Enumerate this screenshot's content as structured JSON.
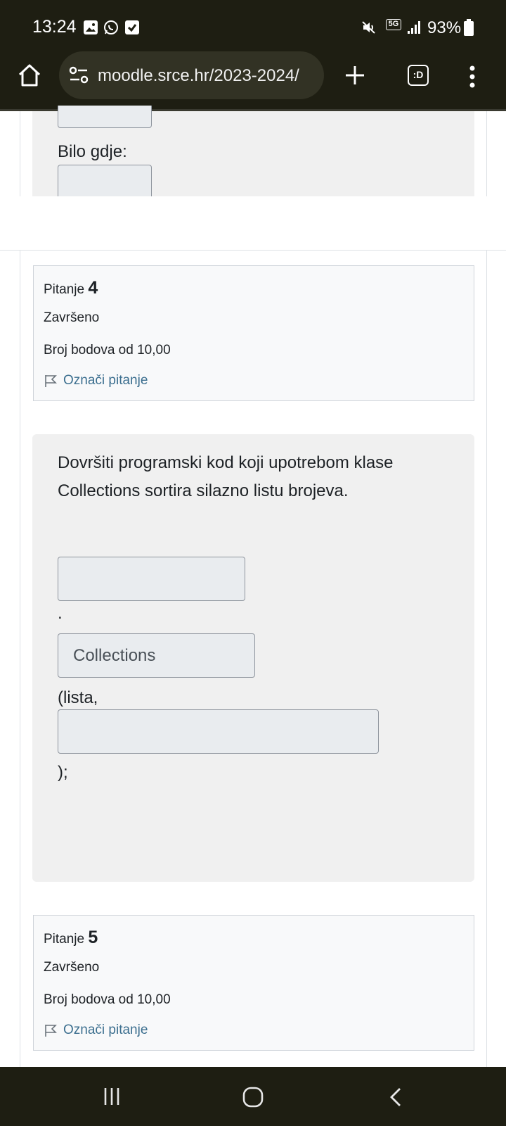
{
  "status_bar": {
    "time": "13:24",
    "battery": "93%",
    "network": "5G",
    "icons": [
      "gallery-icon",
      "whatsapp-icon",
      "checkbox-icon",
      "mute-icon",
      "signal-icon",
      "battery-icon"
    ]
  },
  "browser": {
    "url": "moodle.srce.hr/2023-2024/",
    "icons": [
      "home-icon",
      "site-settings-icon",
      "new-tab-icon",
      "tab-switcher-icon",
      "overflow-menu-icon"
    ],
    "tab_switcher_label": ":D"
  },
  "previous_question": {
    "bilo_gdje_label": "Bilo gdje:"
  },
  "question4": {
    "label": "Pitanje",
    "number": "4",
    "state": "Završeno",
    "grade": "Broj bodova od 10,00",
    "flag_label": "Označi pitanje",
    "text": "Dovršiti programski kod koji upotrebom klase Collections sortira silazno listu brojeva.",
    "dot": ".",
    "field2_value": "Collections",
    "lista_text": "(lista,",
    "closing_text": ");",
    "field1_value": "",
    "field3_value": ""
  },
  "question5": {
    "label": "Pitanje",
    "number": "5",
    "state": "Završeno",
    "grade": "Broj bodova od 10,00",
    "flag_label": "Označi pitanje"
  },
  "nav": {
    "icons": [
      "recent-apps-icon",
      "home-button-icon",
      "back-icon"
    ]
  }
}
